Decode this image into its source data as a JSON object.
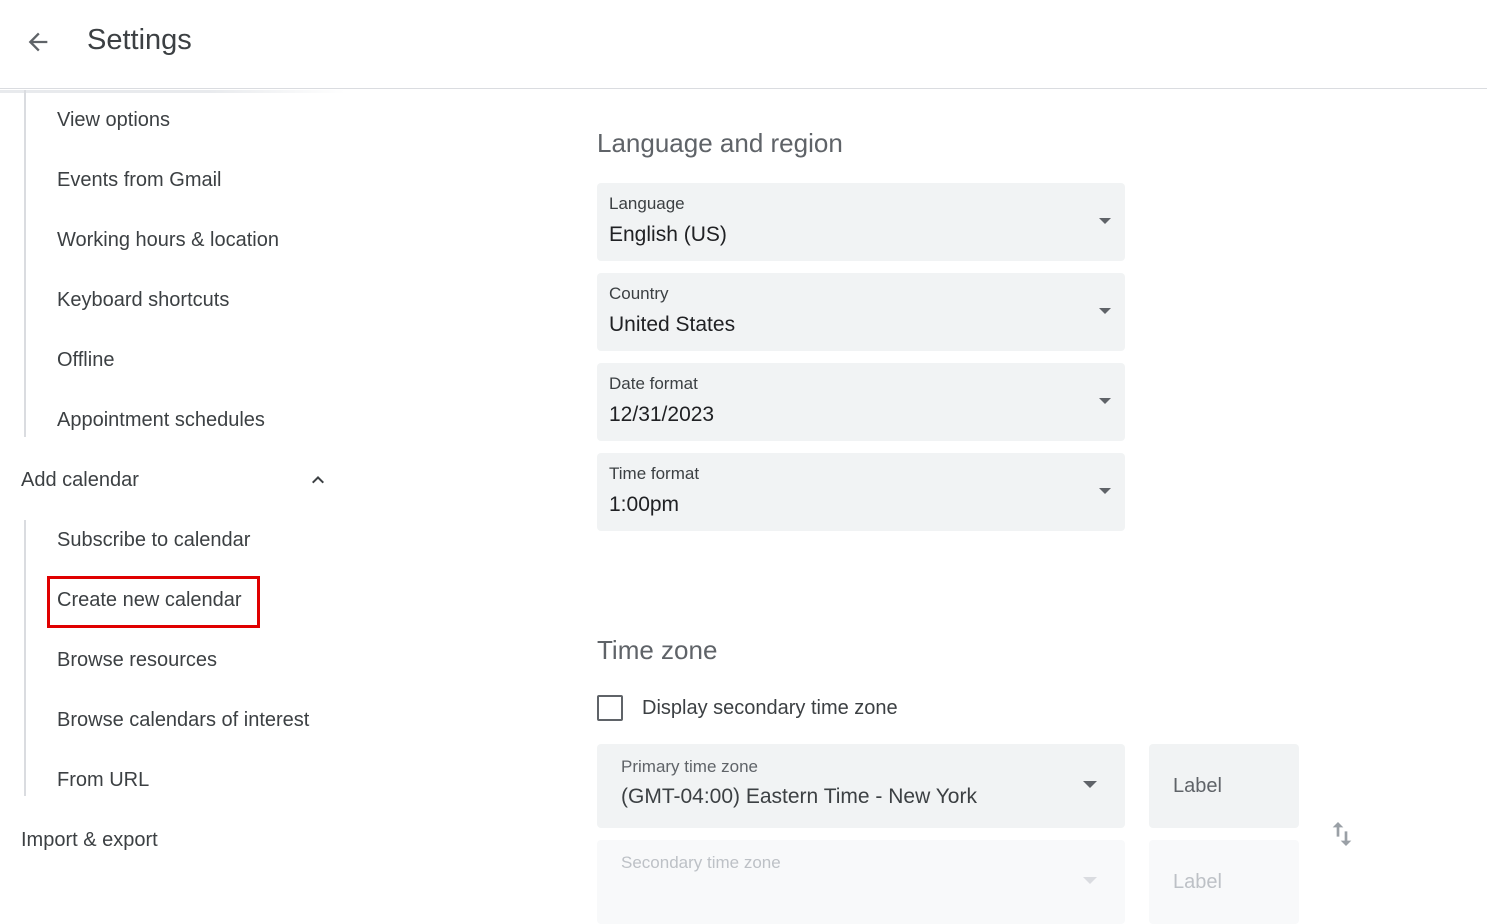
{
  "header": {
    "title": "Settings"
  },
  "sidebar": {
    "general_items": [
      "View options",
      "Events from Gmail",
      "Working hours & location",
      "Keyboard shortcuts",
      "Offline",
      "Appointment schedules"
    ],
    "add_calendar": {
      "label": "Add calendar",
      "items": [
        "Subscribe to calendar",
        "Create new calendar",
        "Browse resources",
        "Browse calendars of interest",
        "From URL"
      ]
    },
    "import_export": "Import & export"
  },
  "language_region": {
    "title": "Language and region",
    "fields": [
      {
        "label": "Language",
        "value": "English (US)"
      },
      {
        "label": "Country",
        "value": "United States"
      },
      {
        "label": "Date format",
        "value": "12/31/2023"
      },
      {
        "label": "Time format",
        "value": "1:00pm"
      }
    ]
  },
  "time_zone": {
    "title": "Time zone",
    "secondary_checkbox_label": "Display secondary time zone",
    "secondary_checked": false,
    "primary": {
      "label": "Primary time zone",
      "value": "(GMT-04:00) Eastern Time - New York"
    },
    "primary_label_placeholder": "Label",
    "secondary": {
      "label": "Secondary time zone"
    },
    "secondary_label_placeholder": "Label"
  },
  "colors": {
    "highlight": "#e00000",
    "field_bg": "#f1f3f4",
    "text": "#3c4043"
  },
  "icons": {
    "back": "arrow-back-icon",
    "collapse": "chevron-up-icon",
    "swap": "swap-vertical-icon",
    "dropdown": "dropdown-triangle-icon"
  }
}
